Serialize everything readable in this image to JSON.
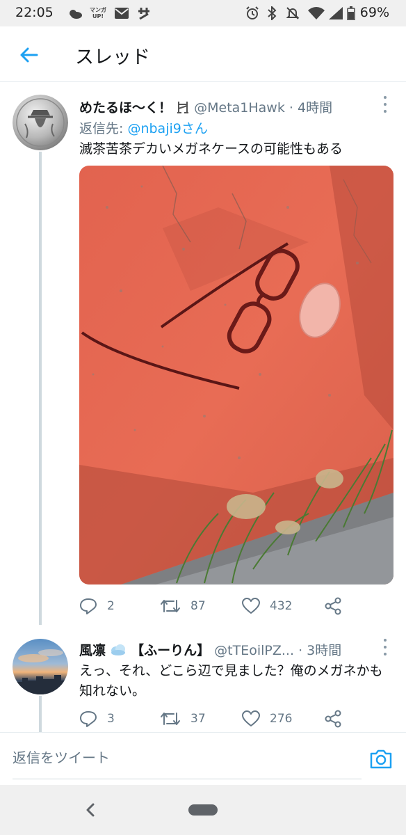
{
  "status_bar": {
    "time": "22:05",
    "battery": "69%",
    "icons": [
      "weather-icon",
      "manga-app-icon",
      "mail-icon",
      "app-notification-icon",
      "alarm-icon",
      "bluetooth-icon",
      "mute-icon",
      "wifi-icon",
      "signal-icon",
      "battery-icon"
    ],
    "manga_label_line1": "マンガ",
    "manga_label_line2": "UP!"
  },
  "app_bar": {
    "title": "スレッド",
    "back_icon": "arrow-left-icon",
    "accent_color": "#1da1f2"
  },
  "tweets": [
    {
      "author_name": "めたるほ〜く！",
      "handle": "@Meta1Hawk",
      "separator": "·",
      "time": "4時間",
      "reply_to_label": "返信先:",
      "reply_to_handle": "@nbaji9さん",
      "text": "滅茶苦茶デカいメガネケースの可能性もある",
      "replies": "2",
      "retweets": "87",
      "likes": "432"
    },
    {
      "author_name": "風凛",
      "author_name_suffix": "【ふーりん】",
      "handle": "@tTEoilPZ...",
      "separator": "·",
      "time": "3時間",
      "text": "えっ、それ、どこら辺で見ました？俺のメガネかも知れない。",
      "replies": "3",
      "retweets": "37",
      "likes": "276"
    }
  ],
  "composer": {
    "placeholder": "返信をツイート",
    "camera_icon": "camera-icon"
  },
  "nav_bar": {
    "back_icon": "chevron-left-icon",
    "home_icon": "home-pill-icon"
  }
}
